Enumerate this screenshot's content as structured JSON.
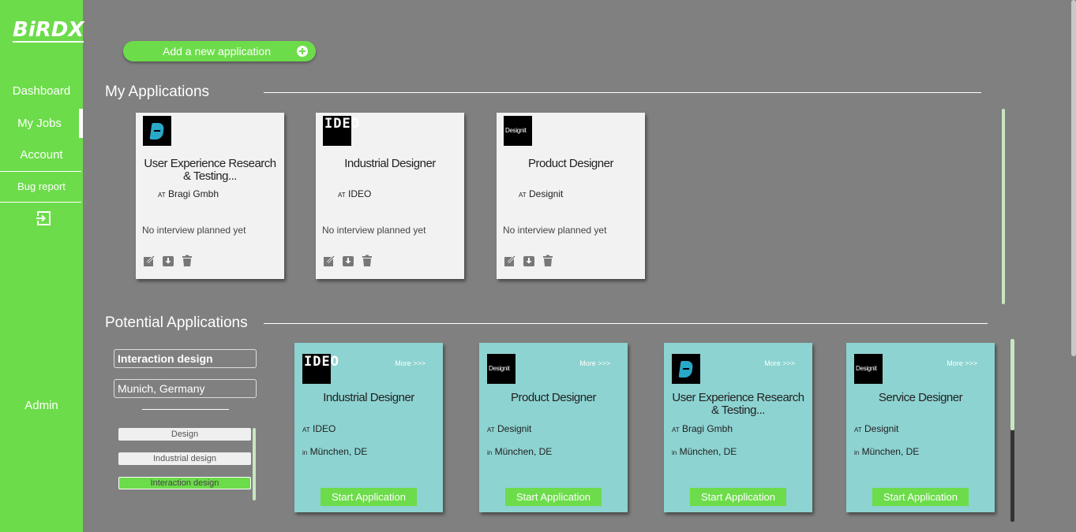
{
  "brand": {
    "logo_text": "BiRDX",
    "accent_color": "#6cdc4a",
    "card_teal": "#8dd3d1"
  },
  "sidebar": {
    "items": [
      {
        "label": "Dashboard"
      },
      {
        "label": "My Jobs",
        "active": true
      },
      {
        "label": "Account"
      },
      {
        "label": "Bug report"
      },
      {
        "label": "Admin"
      }
    ],
    "logout_icon": "logout-icon"
  },
  "add_button": {
    "label": "Add a new application",
    "icon": "plus-circle-icon"
  },
  "my_applications": {
    "title": "My Applications",
    "cards": [
      {
        "logo": "bragi",
        "title": "User Experience Research & Testing...",
        "at": "AT",
        "company": "Bragi Gmbh",
        "status": "No interview planned yet"
      },
      {
        "logo": "ideo",
        "title": "Industrial Designer",
        "at": "AT",
        "company": "IDEO",
        "status": "No interview planned yet"
      },
      {
        "logo": "designit",
        "title": "Product Designer",
        "at": "AT",
        "company": "Designit",
        "status": "No interview planned yet"
      }
    ],
    "action_icons": [
      "edit-icon",
      "download-icon",
      "trash-icon"
    ]
  },
  "potential_applications": {
    "title": "Potential Applications",
    "filters": {
      "keyword": "Interaction design",
      "location": "Munich, Germany"
    },
    "tags": [
      {
        "label": "Design",
        "selected": false
      },
      {
        "label": "Industrial design",
        "selected": false
      },
      {
        "label": "Interaction design",
        "selected": true
      }
    ],
    "cards": [
      {
        "logo": "ideo",
        "more": "More >>>",
        "title": "Industrial Designer",
        "at": "AT",
        "company": "IDEO",
        "in": "in",
        "location": "München, DE",
        "button": "Start Application"
      },
      {
        "logo": "designit",
        "more": "More >>>",
        "title": "Product Designer",
        "at": "AT",
        "company": "Designit",
        "in": "in",
        "location": "München, DE",
        "button": "Start Application"
      },
      {
        "logo": "bragi",
        "more": "More >>>",
        "title": "User Experience Research & Testing...",
        "at": "AT",
        "company": "Bragi Gmbh",
        "in": "in",
        "location": "München, DE",
        "button": "Start Application"
      },
      {
        "logo": "designit",
        "more": "More >>>",
        "title": "Service Designer",
        "at": "AT",
        "company": "Designit",
        "in": "in",
        "location": "München, DE",
        "button": "Start Application"
      }
    ]
  },
  "logo_texts": {
    "ideo": "IDEO",
    "designit": "Designit"
  }
}
